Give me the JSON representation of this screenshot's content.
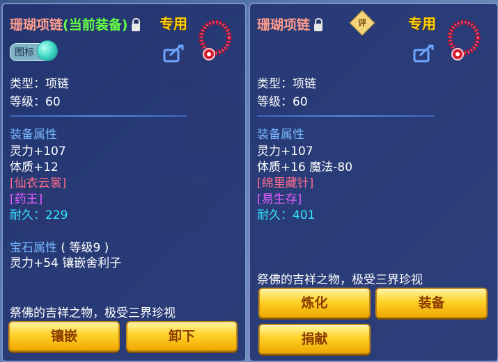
{
  "left": {
    "title": "珊瑚项链",
    "title_status": "(当前装备)",
    "special": "专用",
    "badge": "图标",
    "type_line": "类型：项链",
    "level_line": "等级：60",
    "equip_attr_title": "装备属性",
    "attr1": "灵力+107",
    "attr2": "体质+12",
    "special1": "[仙衣云裳]",
    "special2": "[药王]",
    "durability_label": "耐久：",
    "durability_value": "229",
    "gem_title": "宝石属性",
    "gem_level": "( 等级9 )",
    "gem_attr": "灵力+54 镶嵌舍利子",
    "desc": "祭佛的吉祥之物，极受三界珍视",
    "btn1": "镶嵌",
    "btn2": "卸下"
  },
  "right": {
    "title": "珊瑚项链",
    "ping": "评",
    "special": "专用",
    "type_line": "类型：项链",
    "level_line": "等级：60",
    "equip_attr_title": "装备属性",
    "attr1": "灵力+107",
    "attr2": "体质+16 魔法-80",
    "special1": "[绵里藏针]",
    "special2": "[易生存]",
    "durability_label": "耐久：",
    "durability_value": "401",
    "desc": "祭佛的吉祥之物，极受三界珍视",
    "btn1": "炼化",
    "btn2": "装备",
    "btn3": "捐献"
  },
  "colors": {
    "title": "#ff9c8c",
    "current_equip": "#66ff44",
    "special": "#ffd200",
    "attr_title": "#79b8ff",
    "special_skill": "#ff6b8c",
    "pink_skill": "#e35cff",
    "durability": "#33e5ff",
    "button": "#ffd22a"
  },
  "icons": [
    "lock-open-icon",
    "ping-icon",
    "necklace-icon",
    "share-icon",
    "toggle-icon"
  ]
}
